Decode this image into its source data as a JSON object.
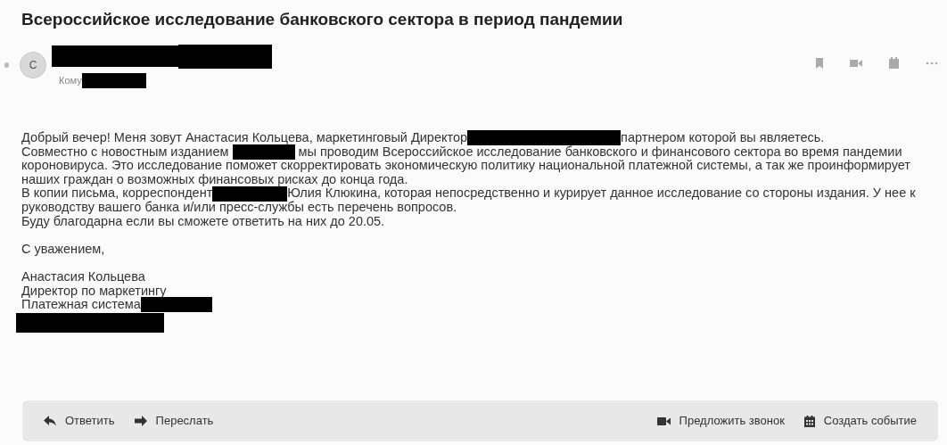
{
  "subject": "Всероссийское исследование банковского сектора в период пандемии",
  "header": {
    "avatar_letter": "С",
    "to_label": "Кому"
  },
  "body": [
    [
      [
        {
          "kind": "text",
          "text": "Добрый вечер! Меня зовут Анастасия Кольцева, маркетинговый Директор"
        },
        {
          "kind": "redaction"
        },
        {
          "kind": "text",
          "text": "партнером которой вы являетесь."
        }
      ],
      [
        {
          "kind": "text",
          "text": "Совместно с новостным изданием "
        },
        {
          "kind": "redaction"
        },
        {
          "kind": "text",
          "text": " мы проводим Всероссийское исследование банковского и финансового сектора во время пандемии"
        }
      ],
      [
        {
          "kind": "text",
          "text": "короновируса. Это исследование поможет скорректировать экономическую политику национальной платежной системы, а так же проинформирует"
        }
      ],
      [
        {
          "kind": "text",
          "text": "наших граждан о возможных финансовых рисках до конца года."
        }
      ],
      [
        {
          "kind": "text",
          "text": "В копии письма, корреспондент"
        },
        {
          "kind": "redaction"
        },
        {
          "kind": "text",
          "text": "Юлия Клюкина, которая непосредственно и курирует данное исследование со стороны издания. У нее к"
        }
      ],
      [
        {
          "kind": "text",
          "text": "руководству вашего банка и/или пресс-службы есть перечень вопросов."
        }
      ],
      [
        {
          "kind": "text",
          "text": "Буду благодарна если вы сможете ответить на них до 20.05."
        }
      ]
    ],
    [
      [
        {
          "kind": "text",
          "text": "С уважением,"
        }
      ]
    ],
    [
      [
        {
          "kind": "text",
          "text": "Анастасия Кольцева"
        }
      ],
      [
        {
          "kind": "text",
          "text": "Директор по маркетингу"
        }
      ],
      [
        {
          "kind": "text",
          "text": "Платежная система"
        },
        {
          "kind": "redaction"
        }
      ],
      [
        {
          "kind": "redaction"
        }
      ]
    ]
  ],
  "actions_left": [
    {
      "kind": "reply",
      "label": "Ответить"
    },
    {
      "kind": "forward",
      "label": "Переслать"
    }
  ],
  "actions_right": [
    {
      "kind": "call",
      "label": "Предложить звонок"
    },
    {
      "kind": "event",
      "label": "Создать событие"
    }
  ]
}
